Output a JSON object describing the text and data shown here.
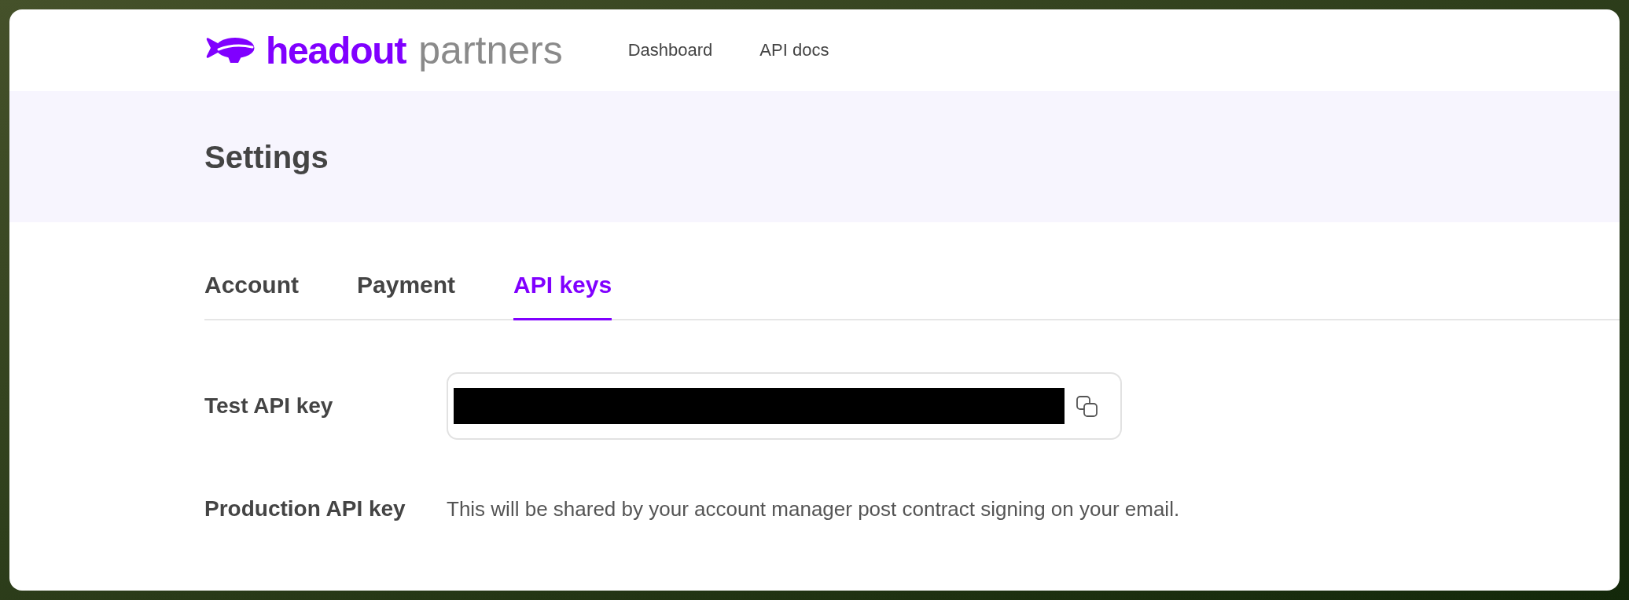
{
  "header": {
    "logo": {
      "wordmark": "headout",
      "subtitle": "partners"
    },
    "nav": [
      {
        "label": "Dashboard"
      },
      {
        "label": "API docs"
      }
    ]
  },
  "page_title": "Settings",
  "tabs": [
    {
      "label": "Account",
      "selected": false
    },
    {
      "label": "Payment",
      "selected": false
    },
    {
      "label": "API keys",
      "selected": true
    }
  ],
  "fields": [
    {
      "kind": "secret",
      "label": "Test API key"
    },
    {
      "kind": "text",
      "label": "Production API key",
      "text": "This will be shared by your account manager post contract signing on your email."
    }
  ]
}
